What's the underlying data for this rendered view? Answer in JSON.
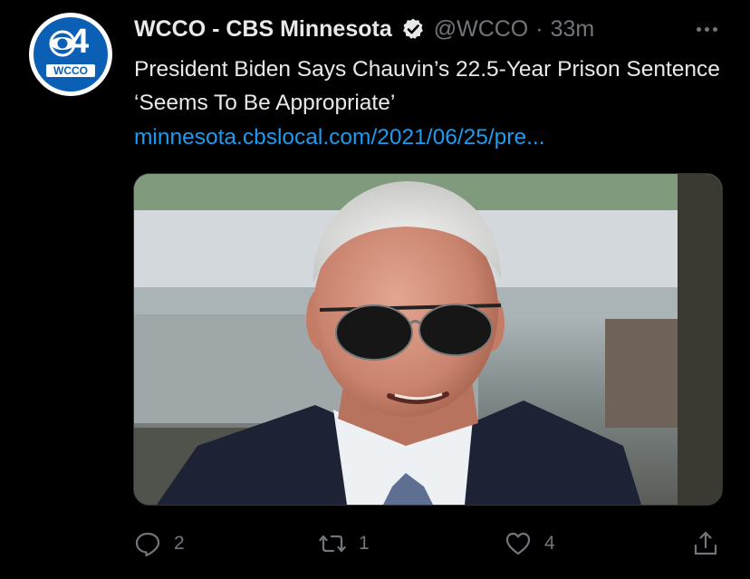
{
  "account": {
    "display_name": "WCCO - CBS Minnesota",
    "handle": "@WCCO",
    "separator": "·",
    "time": "33m",
    "avatar": {
      "channel": "4",
      "call_sign": "WCCO",
      "color": "#0b60b6"
    },
    "verified_icon": "verified-badge-icon"
  },
  "tweet": {
    "text": "President Biden Says Chauvin’s 22.5-Year Prison Sentence ‘Seems To Be Appropriate’",
    "link": "minnesota.cbslocal.com/2021/06/25/pre..."
  },
  "actions": {
    "reply": {
      "icon": "reply-icon",
      "count": "2"
    },
    "retweet": {
      "icon": "retweet-icon",
      "count": "1"
    },
    "like": {
      "icon": "heart-icon",
      "count": "4"
    },
    "share": {
      "icon": "share-icon"
    }
  },
  "colors": {
    "background": "#000000",
    "primary_text": "#e7e9ea",
    "secondary_text": "#71767b",
    "link": "#1d9bf0"
  }
}
